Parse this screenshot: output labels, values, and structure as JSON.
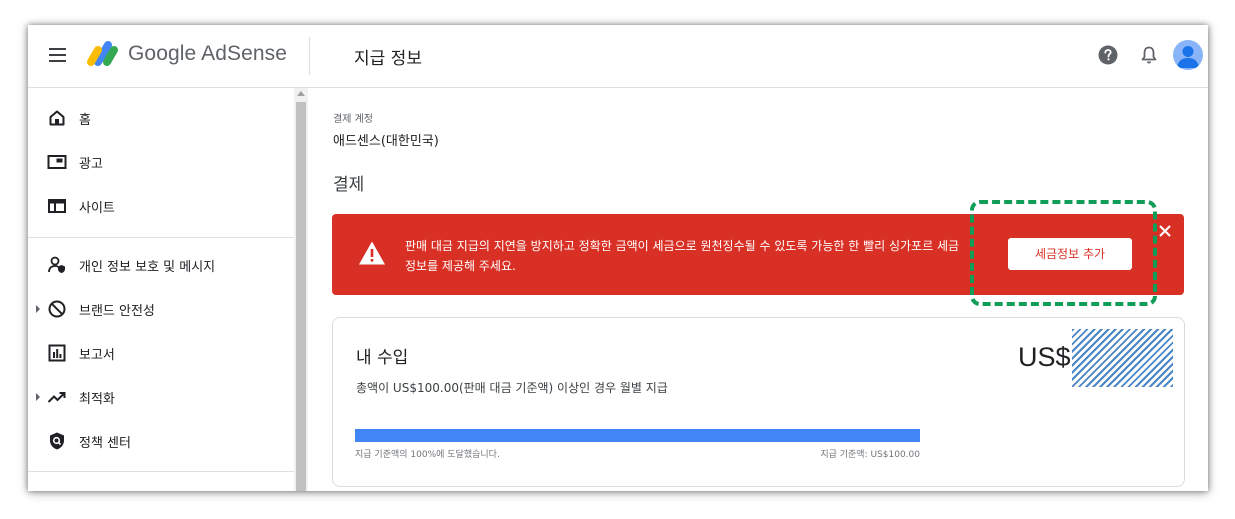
{
  "header": {
    "brand": "Google AdSense",
    "page_title": "지급 정보",
    "icons": [
      "menu-icon",
      "adsense-logo",
      "help-icon",
      "bell-icon",
      "avatar"
    ]
  },
  "sidebar": {
    "items": [
      {
        "label": "홈",
        "icon": "home-icon"
      },
      {
        "label": "광고",
        "icon": "ads-icon"
      },
      {
        "label": "사이트",
        "icon": "sites-icon"
      },
      {
        "label": "개인 정보 보호 및 메시지",
        "icon": "privacy-icon"
      },
      {
        "label": "브랜드 안전성",
        "icon": "block-icon"
      },
      {
        "label": "보고서",
        "icon": "reports-icon"
      },
      {
        "label": "최적화",
        "icon": "trending-icon"
      },
      {
        "label": "정책 센터",
        "icon": "policy-shield-icon"
      }
    ]
  },
  "main": {
    "account_label": "결제 계정",
    "account_value": "애드센스(대한민국)",
    "section_title": "결제",
    "alert": {
      "message": "판매 대금 지급의 지연을 방지하고 정확한 금액이 세금으로 원천징수될 수 있도록 가능한 한 빨리 싱가포르 세금 정보를 제공해 주세요.",
      "button_label": "세금정보 추가",
      "color": "#d93025"
    },
    "earnings": {
      "title": "내 수입",
      "currency": "US$",
      "description": "총액이 US$100.00(판매 대금 기준액) 이상인 경우 월별 지급",
      "progress_fraction": 1.0,
      "progress_left": "지급 기준액의 100%에 도달했습니다.",
      "progress_right": "지급 기준액: US$100.00",
      "progress_color": "#4285f4"
    }
  },
  "colors": {
    "highlight": "#0f9d58"
  }
}
